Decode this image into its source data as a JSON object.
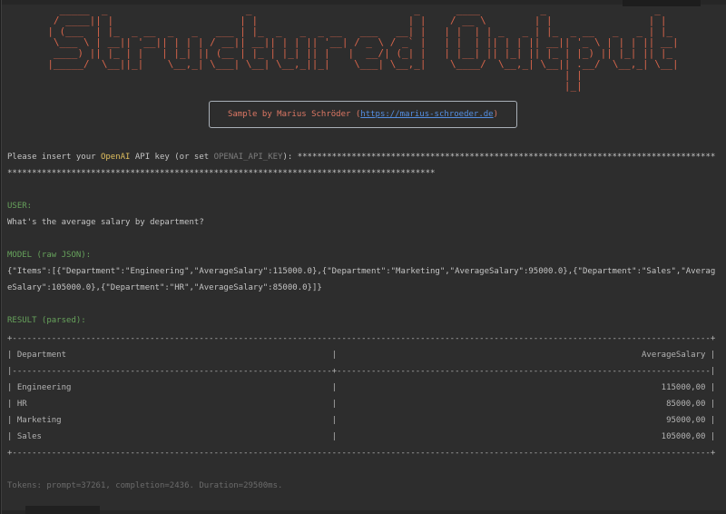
{
  "banner": {
    "text": "Structured Output",
    "color": "#d5644a",
    "glyphs": {
      "S": [
        "  _____ ",
        " / ____|",
        "| (___  ",
        " \\___ \\ ",
        " ____) |",
        "|_____/ ",
        "        ",
        "        "
      ],
      "t": [
        " _   ",
        "| |  ",
        "| |_ ",
        "| __|",
        "| |_ ",
        " \\__|",
        "     ",
        "     "
      ],
      "r": [
        "      ",
        "      ",
        " _ __ ",
        "| '__|",
        "| |   ",
        "|_|   ",
        "      ",
        "      "
      ],
      "u": [
        "       ",
        "       ",
        " _   _ ",
        "| | | |",
        "| |_| |",
        " \\__,_|",
        "       ",
        "       "
      ],
      "c": [
        "      ",
        "      ",
        "  ___ ",
        " / __|",
        "| (__ ",
        " \\___|",
        "      ",
        "      "
      ],
      "e": [
        "      ",
        "      ",
        "  ___ ",
        " / _ \\",
        "|  __/",
        " \\___|",
        "      ",
        "      "
      ],
      "d": [
        "     _ ",
        "    | |",
        "  __| |",
        " / _` |",
        "| (_| |",
        " \\__,_|",
        "       ",
        "       "
      ],
      " ": [
        "   ",
        "   ",
        "   ",
        "   ",
        "   ",
        "   ",
        "   ",
        "   "
      ],
      "O": [
        "  ____  ",
        " / __ \\ ",
        "| |  | |",
        "| |  | |",
        "| |__| |",
        " \\____/ ",
        "        ",
        "        "
      ],
      "p": [
        "       ",
        "       ",
        " _ __  ",
        "| '_ \\ ",
        "| |_) |",
        "| .__/ ",
        "| |    ",
        "|_|    "
      ]
    }
  },
  "sample_box": {
    "prefix": "Sample by Marius Schröder (",
    "link": "https://marius-schroeder.de",
    "suffix": ")"
  },
  "api_key_prompt": {
    "before_product": "Please insert your ",
    "product": "OpenAI",
    "middle": " API key (or set ",
    "env_var": "OPENAI_API_KEY",
    "after": "): ",
    "masked_key": "****************************************************************************************************************************************************************************"
  },
  "user_section": {
    "label": "USER:",
    "message": "What's the average salary by department?"
  },
  "model_section": {
    "label": "MODEL (raw JSON):",
    "raw_json": "{\"Items\":[{\"Department\":\"Engineering\",\"AverageSalary\":115000.0},{\"Department\":\"Marketing\",\"AverageSalary\":95000.0},{\"Department\":\"Sales\",\"AverageSalary\":105000.0},{\"Department\":\"HR\",\"AverageSalary\":85000.0}]}"
  },
  "result_section": {
    "label": "RESULT (parsed):"
  },
  "result_table": {
    "type": "table",
    "columns": [
      "Department",
      "AverageSalary"
    ],
    "rows": [
      [
        "Engineering",
        "115000,00"
      ],
      [
        "HR",
        "85000,00"
      ],
      [
        "Marketing",
        "95000,00"
      ],
      [
        "Sales",
        "105000,00"
      ]
    ],
    "width_chars": 144,
    "divider_col": 66
  },
  "footer": {
    "stats": "Tokens: prompt=37261, completion=2436. Duration=29500ms."
  },
  "colors": {
    "background": "#2d2d2d",
    "banner_orange": "#d5644a",
    "sample_orange": "#de7865",
    "link_blue": "#548fe3",
    "box_border_gray": "#a9b0b8",
    "openai_yellow": "#dfbe5e",
    "env_var_gray": "#7d7d7d",
    "section_green": "#67a35c",
    "body_text": "#c4c4c4",
    "table_gray": "#b3b3b3",
    "footer_gray": "#6b6b6b"
  }
}
